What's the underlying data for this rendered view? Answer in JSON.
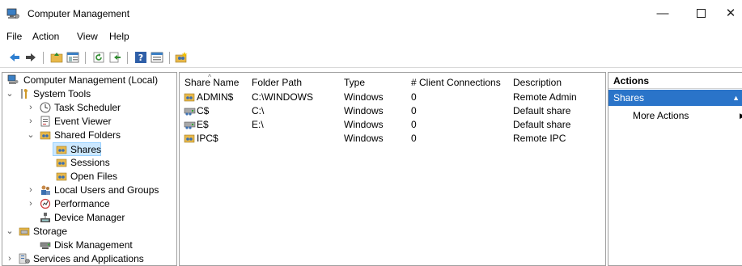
{
  "window": {
    "title": "Computer Management",
    "minimize": "—",
    "close": "✕"
  },
  "menu": [
    "File",
    "Action",
    "View",
    "Help"
  ],
  "toolbar": {
    "icons": [
      "back-icon",
      "forward-icon",
      "up-folder-icon",
      "show-hide-tree-icon",
      "refresh-icon",
      "export-list-icon",
      "help-icon",
      "properties-icon",
      "new-share-icon"
    ]
  },
  "tree": {
    "root": "Computer Management (Local)",
    "system_tools": "System Tools",
    "task_scheduler": "Task Scheduler",
    "event_viewer": "Event Viewer",
    "shared_folders": "Shared Folders",
    "shares": "Shares",
    "sessions": "Sessions",
    "open_files": "Open Files",
    "local_users": "Local Users and Groups",
    "performance": "Performance",
    "device_manager": "Device Manager",
    "storage": "Storage",
    "disk_management": "Disk Management",
    "services_apps": "Services and Applications"
  },
  "list": {
    "columns": [
      "Share Name",
      "Folder Path",
      "Type",
      "# Client Connections",
      "Description"
    ],
    "rows": [
      {
        "name": "ADMIN$",
        "path": "C:\\WINDOWS",
        "type": "Windows",
        "connections": "0",
        "description": "Remote Admin",
        "icon": "shared-folder-icon"
      },
      {
        "name": "C$",
        "path": "C:\\",
        "type": "Windows",
        "connections": "0",
        "description": "Default share",
        "icon": "shared-drive-icon"
      },
      {
        "name": "E$",
        "path": "E:\\",
        "type": "Windows",
        "connections": "0",
        "description": "Default share",
        "icon": "shared-drive-icon"
      },
      {
        "name": "IPC$",
        "path": "",
        "type": "Windows",
        "connections": "0",
        "description": "Remote IPC",
        "icon": "shared-folder-icon"
      }
    ]
  },
  "actions": {
    "header": "Actions",
    "section": "Shares",
    "more": "More Actions"
  },
  "colors": {
    "accent": "#2a74c9",
    "selection": "#cce8ff"
  }
}
